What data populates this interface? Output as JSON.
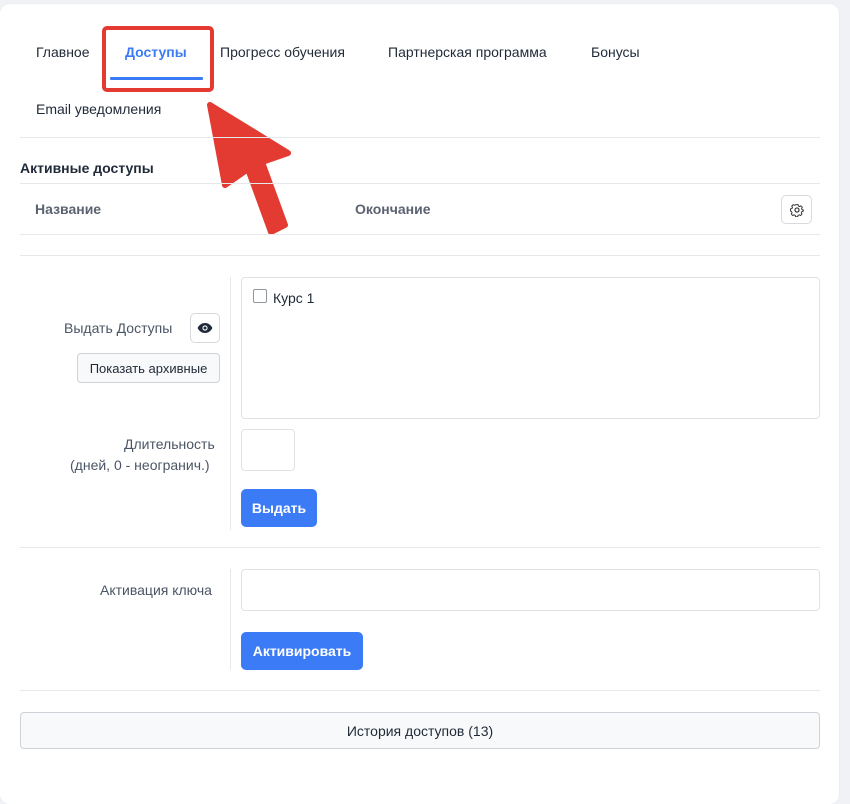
{
  "tabs": [
    {
      "label": "Главное"
    },
    {
      "label": "Доступы",
      "active": true
    },
    {
      "label": "Прогресс обучения"
    },
    {
      "label": "Партнерская программа"
    },
    {
      "label": "Бонусы"
    },
    {
      "label": "Email уведомления"
    }
  ],
  "active_access": {
    "title": "Активные доступы",
    "columns": [
      "Название",
      "Окончание"
    ],
    "settings_icon": "gear-icon"
  },
  "grant": {
    "label": "Выдать Доступы",
    "eye_icon": "eye-icon",
    "show_archived_label": "Показать архивные",
    "courses": [
      {
        "name": "Курс 1",
        "checked": false
      }
    ],
    "duration_label_line1": "Длительность",
    "duration_label_line2": "(дней, 0 - неогранич.)",
    "duration_value": "",
    "submit_label": "Выдать"
  },
  "key": {
    "label": "Активация ключа",
    "value": "",
    "submit_label": "Активировать"
  },
  "history_label": "История доступов (13)",
  "colors": {
    "accent": "#3b7bf6",
    "highlight": "#e33b32"
  }
}
